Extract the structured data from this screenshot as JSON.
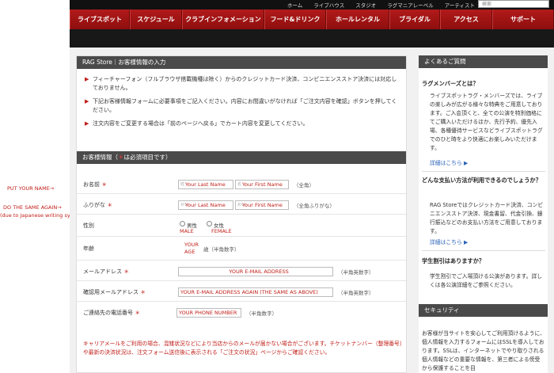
{
  "annotations": {
    "name": "PUT YOUR NAME→",
    "same_again": "DO THE SAME AGAIN→",
    "due": "(due to Japanese writing system)"
  },
  "topbar": {
    "links": [
      "ホーム",
      "ライブハウス",
      "スタジオ",
      "ラグマニアレーベル",
      "アーティスト"
    ],
    "search_placeholder": "検索"
  },
  "nav": {
    "items": [
      "ライブスポット",
      "スケジュール",
      "クラブインフォメーション",
      "フード&ドリンク",
      "ホールレンタル",
      "ブライダル",
      "アクセス",
      "サポート"
    ]
  },
  "main": {
    "title": "RAG Store｜お客様情報の入力",
    "notes": [
      "フィーチャーフォン（フルブラウザ搭載機種は除く）からのクレジットカード決済、コンビニエンスストア決済には対応しておりません。",
      "下記お客様情報フォームに必要事項をご記入ください。内容にお間違いがなければ「ご注文内容を確認」ボタンを押してください。",
      "注文内容をご変更する場合は「前のページへ戻る」でカート内容を変更してください。"
    ],
    "section_title": "お客様情報（",
    "section_req": "＊",
    "section_title_end": "は必須項目です）",
    "form": {
      "name_label": "お名前",
      "last_name_tiny": "姓",
      "last_name": "Your Last Name",
      "first_name_tiny": "名",
      "first_name": "Your First Name",
      "name_hint": "（全角）",
      "kana_label": "ふりがな",
      "kana_last_tiny": "せい",
      "kana_last": "Your Last Name",
      "kana_first_tiny": "めい",
      "kana_first": "Your First Name",
      "kana_hint": "（全角ふりがな）",
      "gender_label": "性別",
      "male": "男性",
      "male_en": "MALE",
      "female": "女性",
      "female_en": "FEMALE",
      "age_label": "年齢",
      "age_value": "YOUR AGE",
      "age_unit": "歳（半角数字）",
      "email_label": "メールアドレス",
      "email_value": "YOUR E-MAIL ADDRESS",
      "email_hint": "（半角英数字）",
      "email2_label": "確認用メールアドレス",
      "email2_value": "YOUR E-MAIL ADDRESS AGAIN (THE SAME AS ABOVE)",
      "email2_hint": "（半角英数字）",
      "phone_label": "ご連絡先の電話番号",
      "phone_value": "YOUR PHONE NUMBER",
      "phone_hint": "（半角数字）",
      "star": "＊"
    },
    "footer_note": "キャリアメールをご利用の場合、混雑状況などにより当店からのメールが届かない場合がございます。チケットナンバー（整理番号）や最新の決済状況は、注文フォーム送信後に表示される「ご注文の状況」ページからご確認ください。"
  },
  "sidebar": {
    "faq_title": "よくあるご質問",
    "q1": "ラグメンバーズとは？",
    "a1": "ライブスポットラグ・メンバーズでは、ライブの楽しみが広がる様々な特典をご用意しております。ご入会頂くと、全ての公演を特別価格にてご購入いただけるほか、先行予約、優先入場、各種優待サービスなどライブスポットラグでのひと時をより快適にお楽しみいただけます。",
    "more1": "詳細はこちら ▶",
    "q2": "どんな支払い方法が利用できるのでしょうか？",
    "a2": "RAG Storeではクレジットカード決済、コンビニエンスストア決済、現金書留、代金引換、銀行振込などのお支払い方法をご用意しております。",
    "more2": "詳細はこちら ▶",
    "q3": "学生割引はありますか？",
    "a3": "学生割引でご入場頂ける公演があります。詳しくは各公演詳細をご参照ください。",
    "security_title": "セキュリティ",
    "security_text": "お客様が当サイトを安心してご利用頂けるように、個人情報を入力するフォームにはSSLを導入しております。SSLは、インターネットでやり取りされる個人情報などの重要な情報を、第三者による傍受から保護することを目"
  }
}
